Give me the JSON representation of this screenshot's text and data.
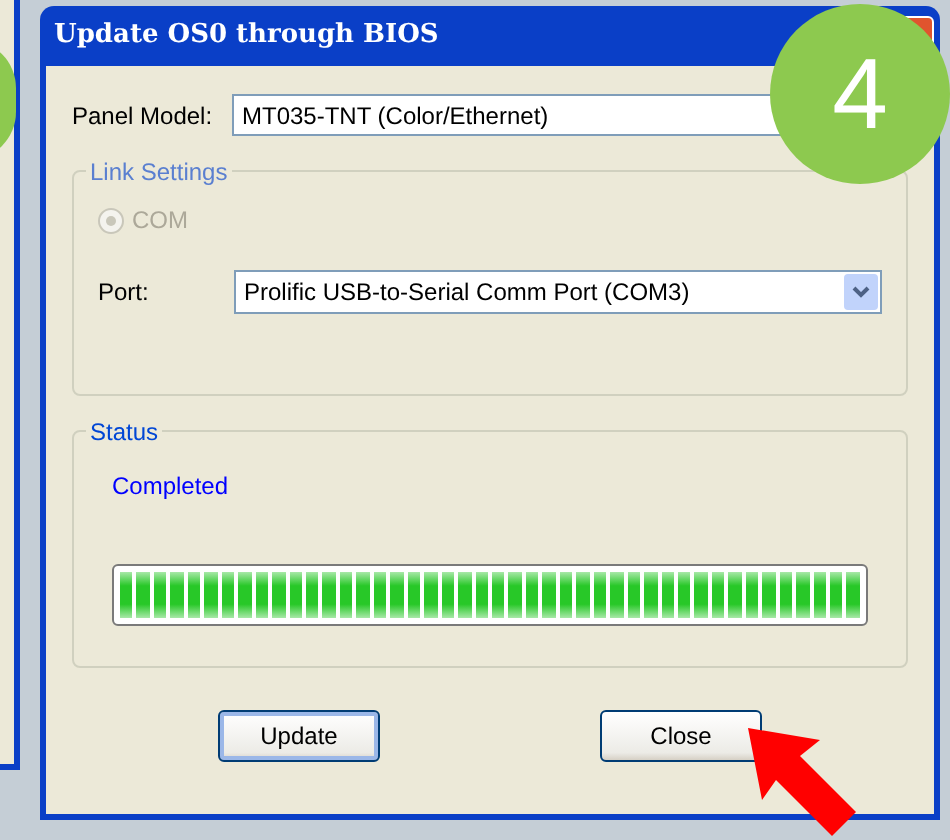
{
  "window": {
    "title": "Update OS0 through BIOS"
  },
  "step_badge": "4",
  "panel_model": {
    "label": "Panel Model:",
    "value": "MT035-TNT (Color/Ethernet)"
  },
  "link_settings": {
    "title": "Link Settings",
    "disabled": true,
    "radio": {
      "label": "COM",
      "selected": true
    },
    "port": {
      "label": "Port:",
      "value": "Prolific USB-to-Serial Comm Port (COM3)"
    }
  },
  "status": {
    "title": "Status",
    "message": "Completed",
    "level": 1
  },
  "buttons": [
    {
      "label": "Update",
      "focused": true
    },
    {
      "label": "Close",
      "focused": false
    }
  ]
}
